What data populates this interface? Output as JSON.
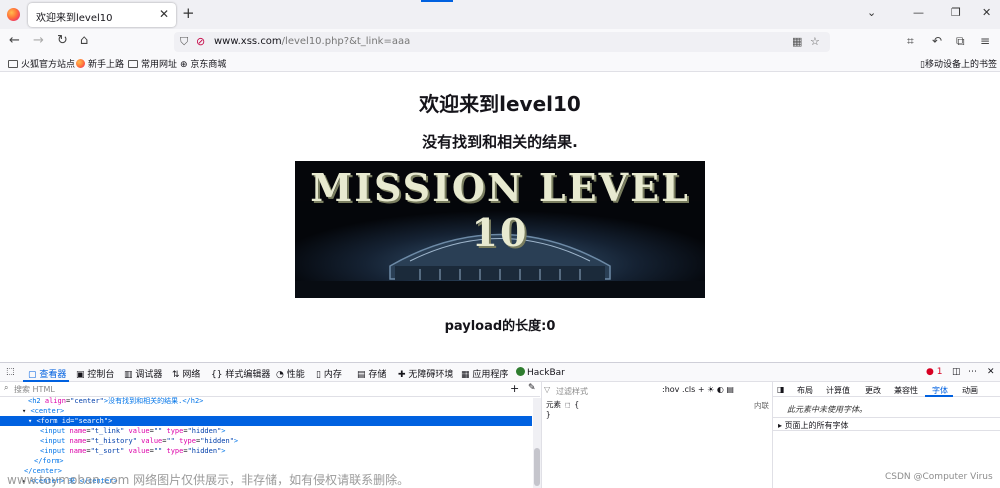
{
  "browser": {
    "tab_title": "欢迎来到level10",
    "url_host": "www.xss.com",
    "url_path": "/level10.php?&t_link=aaa",
    "icons": [
      "firefox-icon",
      "back-icon",
      "forward-icon",
      "reload-icon",
      "home-icon",
      "shield-icon",
      "lock-icon",
      "qr-icon",
      "star-icon",
      "extensions-icon"
    ]
  },
  "bookmarks": {
    "items": [
      "火狐官方站点",
      "新手上路",
      "常用网址",
      "京东商城"
    ],
    "mobile": "移动设备上的书签"
  },
  "page": {
    "heading": "欢迎来到level10",
    "subheading": "没有找到和相关的结果.",
    "banner_text": "MISSION LEVEL 10",
    "payload_text": "payload的长度:0"
  },
  "devtools": {
    "tabs": [
      "查看器",
      "控制台",
      "调试器",
      "网络",
      "样式编辑器",
      "性能",
      "内存",
      "存储",
      "无障碍环境",
      "应用程序",
      "HackBar"
    ],
    "error_count": "1",
    "search_placeholder": "搜索 HTML",
    "tree": {
      "l0_tag": "<h2",
      "l0_attr": "align",
      "l0_val": "\"center\"",
      "l0_text": ">没有找到和相关的结果.</h2>",
      "l1": "<center>",
      "l2_tag": "<form",
      "l2_attr": "id",
      "l2_val": "\"search\"",
      "inputs": [
        {
          "name": "\"t_link\"",
          "value": "\"\"",
          "type": "\"hidden\""
        },
        {
          "name": "\"t_history\"",
          "value": "\"\"",
          "type": "\"hidden\""
        },
        {
          "name": "\"t_sort\"",
          "value": "\"\"",
          "type": "\"hidden\""
        }
      ],
      "form_close": "</form>",
      "center_close": "</center>",
      "last": "<center> 来 </center>"
    },
    "rules": {
      "filter_placeholder": "过滤样式",
      "hov": ":hov",
      "cls": ".cls",
      "element_label": "元素",
      "brace_open": "{",
      "brace_close": "}",
      "inline": "内联"
    },
    "layout": {
      "tabs": [
        "布局",
        "计算值",
        "更改",
        "兼容性",
        "字体",
        "动画"
      ],
      "message": "此元素中未使用字体。",
      "section": "页面上的所有字体"
    }
  },
  "watermark": "www.toymoban.com 网络图片仅供展示，非存储，如有侵权请联系删除。",
  "credit": "CSDN @Computer Virus"
}
